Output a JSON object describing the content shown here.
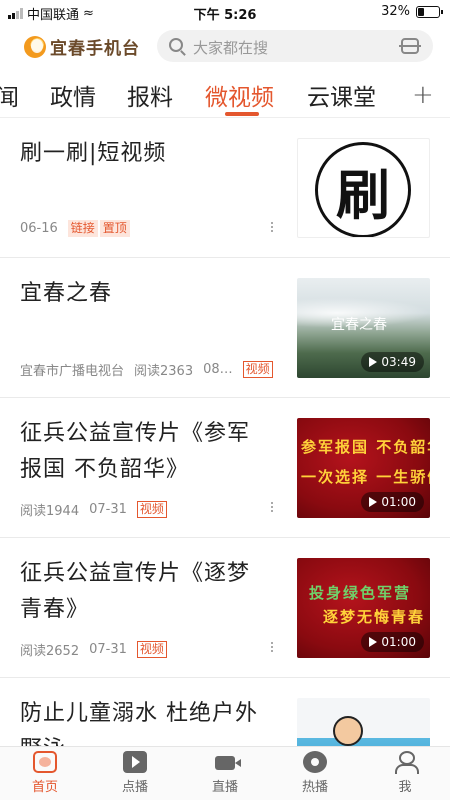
{
  "status_bar": {
    "carrier": "中国联通",
    "time": "下午 5:26",
    "battery": "32%"
  },
  "header": {
    "app_title": "宜春手机台",
    "search_placeholder": "大家都在搜"
  },
  "tabs": [
    {
      "label": "闻",
      "active": false
    },
    {
      "label": "政情",
      "active": false
    },
    {
      "label": "报料",
      "active": false
    },
    {
      "label": "微视频",
      "active": true
    },
    {
      "label": "云课堂",
      "active": false
    }
  ],
  "tab_add_label": "+",
  "feed": [
    {
      "title": "刷一刷|短视频",
      "meta": [
        "06-16"
      ],
      "tags": [
        "链接",
        "置顶"
      ],
      "thumb_text": "刷"
    },
    {
      "title": "宜春之春",
      "meta": [
        "宜春市广播电视台",
        "阅读2363",
        "08…"
      ],
      "tags": [
        "视频"
      ],
      "thumb_overlay": "宜春之春",
      "duration": "03:49"
    },
    {
      "title": "征兵公益宣传片《参军报国 不负韶华》",
      "meta": [
        "阅读1944",
        "07-31"
      ],
      "tags": [
        "视频"
      ],
      "thumb_lines": [
        "参军报国 不负韶华",
        "一次选择 一生骄傲"
      ],
      "duration": "01:00"
    },
    {
      "title": "征兵公益宣传片《逐梦青春》",
      "meta": [
        "阅读2652",
        "07-31"
      ],
      "tags": [
        "视频"
      ],
      "thumb_lines": [
        "投身绿色军营",
        "逐梦无悔青春"
      ],
      "duration": "01:00"
    },
    {
      "title": "防止儿童溺水 杜绝户外野泳",
      "meta": [],
      "tags": []
    }
  ],
  "bottom_nav": [
    {
      "label": "首页",
      "icon": "home-icon",
      "active": true
    },
    {
      "label": "点播",
      "icon": "on-demand-icon",
      "active": false
    },
    {
      "label": "直播",
      "icon": "live-camera-icon",
      "active": false
    },
    {
      "label": "热播",
      "icon": "film-reel-icon",
      "active": false
    },
    {
      "label": "我",
      "icon": "user-icon",
      "active": false
    }
  ],
  "colors": {
    "accent": "#e4572e"
  }
}
